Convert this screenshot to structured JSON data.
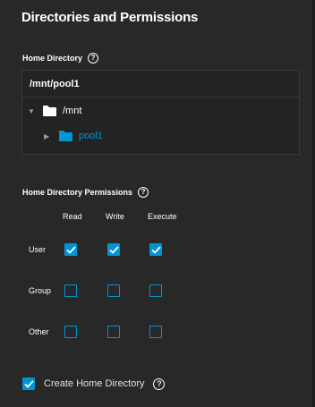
{
  "section": {
    "title": "Directories and Permissions"
  },
  "home_directory": {
    "label": "Home Directory",
    "value": "/mnt/pool1",
    "tree": [
      {
        "label": "/mnt",
        "expanded": true,
        "selected": false
      },
      {
        "label": "pool1",
        "expanded": false,
        "selected": true
      }
    ]
  },
  "permissions": {
    "label": "Home Directory Permissions",
    "columns": [
      "Read",
      "Write",
      "Execute"
    ],
    "rows": [
      {
        "label": "User",
        "values": [
          true,
          true,
          true
        ]
      },
      {
        "label": "Group",
        "values": [
          false,
          false,
          false
        ]
      },
      {
        "label": "Other",
        "values": [
          false,
          false,
          false
        ]
      }
    ]
  },
  "create_home": {
    "label": "Create Home Directory",
    "checked": true
  },
  "colors": {
    "accent": "#0095d5",
    "background": "#282828",
    "folder_selected": "#0095d5",
    "folder": "#ffffff"
  },
  "icons": {
    "help": "help-circle-icon",
    "folder": "folder-icon",
    "expand": "caret-down-icon",
    "collapse": "caret-right-icon",
    "check": "checkmark-icon"
  }
}
